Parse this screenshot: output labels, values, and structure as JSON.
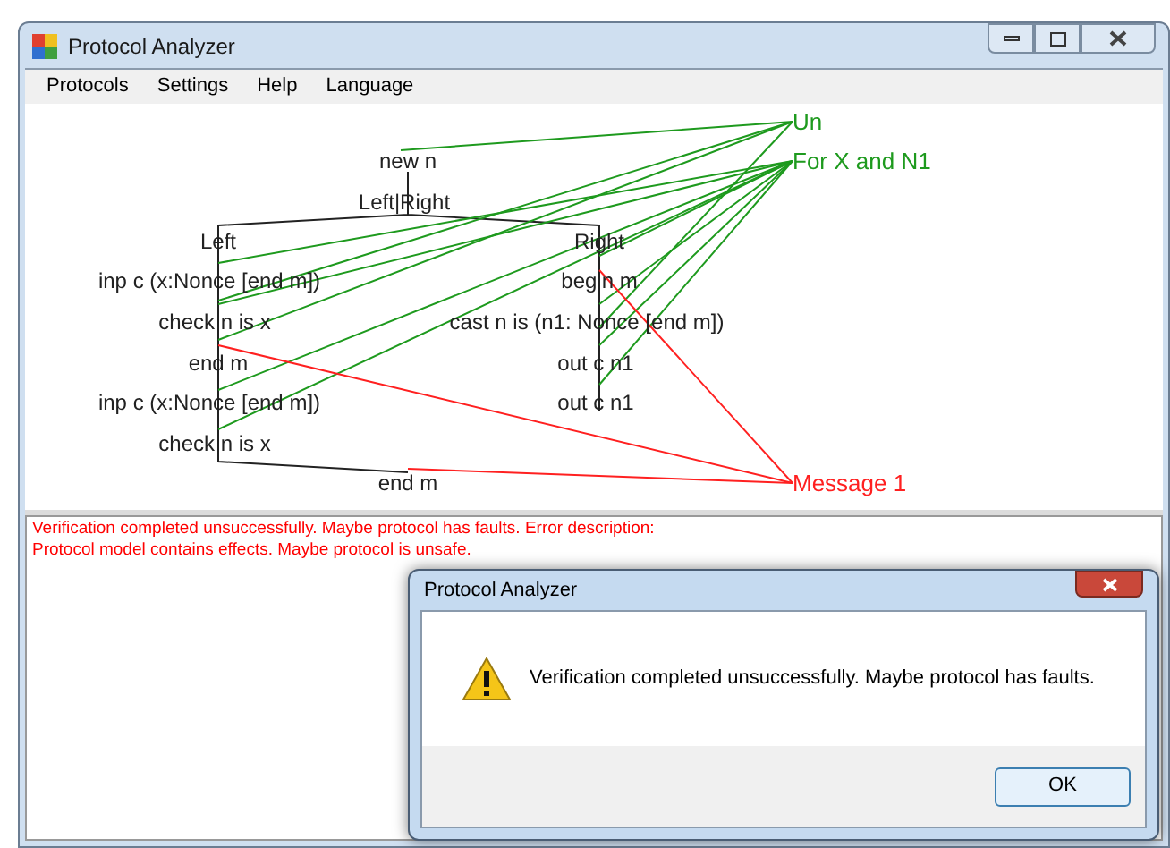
{
  "window": {
    "title": "Protocol Analyzer"
  },
  "menu": [
    "Protocols",
    "Settings",
    "Help",
    "Language"
  ],
  "diagram": {
    "nodes": [
      {
        "label": "new n"
      },
      {
        "label": "Left|Right"
      },
      {
        "label": "Left"
      },
      {
        "label": "Right"
      },
      {
        "label": "inp c (x:Nonce [end m])"
      },
      {
        "label": "begin m"
      },
      {
        "label": "check n is x"
      },
      {
        "label": "cast n is (n1: Nonce [end m])"
      },
      {
        "label": "end m"
      },
      {
        "label": "out c n1"
      },
      {
        "label": "inp c (x:Nonce [end m])"
      },
      {
        "label": "out c n1"
      },
      {
        "label": "check n is x"
      },
      {
        "label": "end m"
      }
    ],
    "labels": [
      {
        "label": "Un",
        "color": "#1e9a1e"
      },
      {
        "label": "For X and N1",
        "color": "#1e9a1e"
      },
      {
        "label": "Message 1",
        "color": "#ff2020"
      }
    ]
  },
  "log": [
    "Verification completed unsuccessfully. Maybe protocol has faults. Error description:",
    "Protocol model contains effects. Maybe protocol is unsafe."
  ],
  "dialog": {
    "title": "Protocol Analyzer",
    "message": "Verification completed unsuccessfully. Maybe protocol has faults.",
    "buttons": [
      "OK"
    ]
  }
}
